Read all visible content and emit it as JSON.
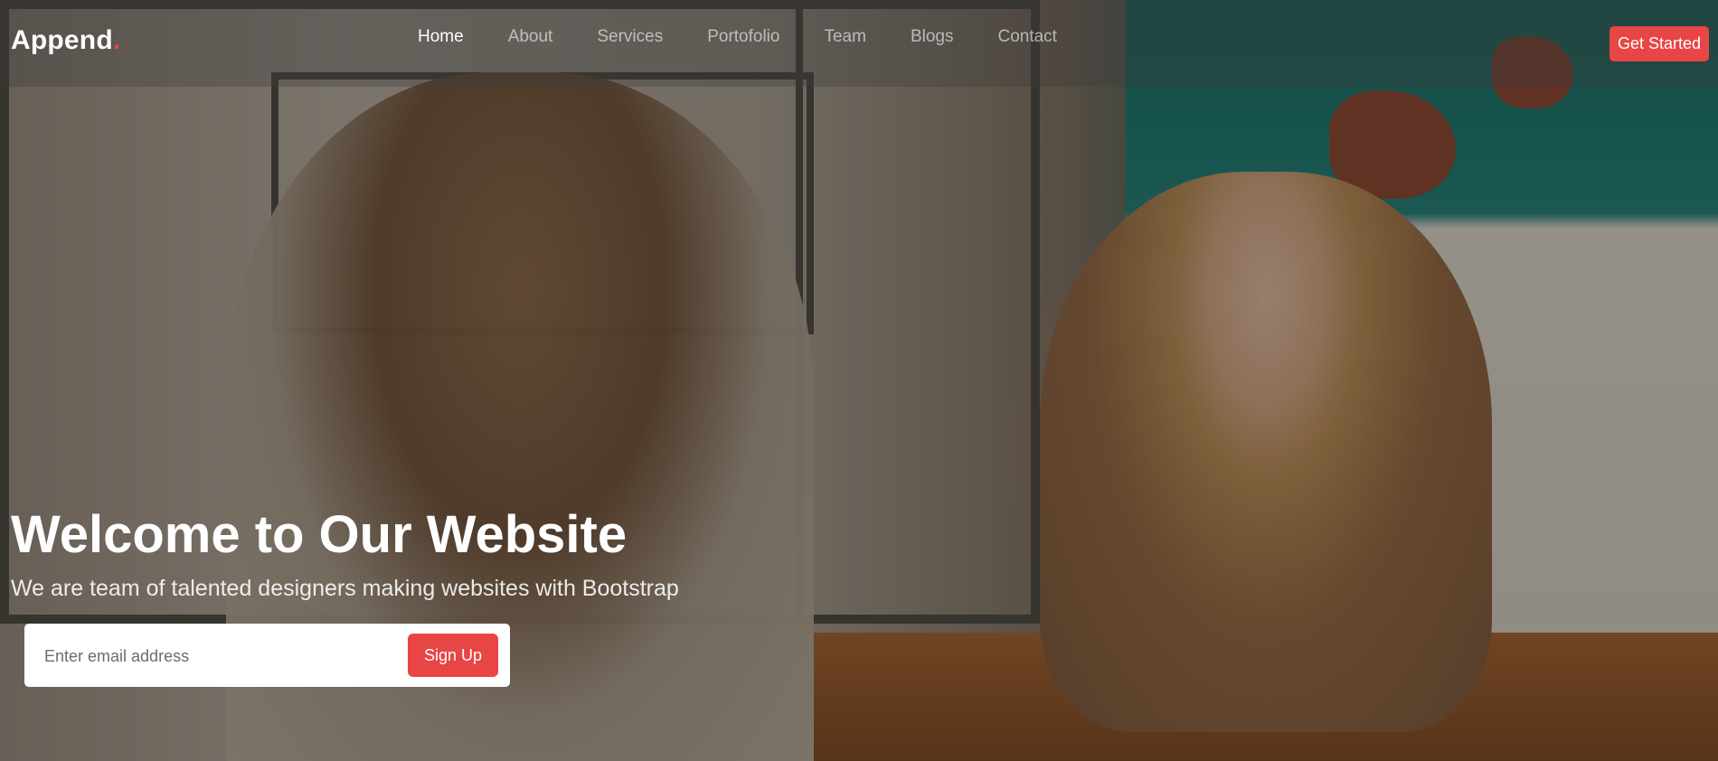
{
  "brand": {
    "name": "Append",
    "dot": ".",
    "accent_color": "#e84545"
  },
  "nav": {
    "items": [
      {
        "label": "Home",
        "active": true
      },
      {
        "label": "About",
        "active": false
      },
      {
        "label": "Services",
        "active": false
      },
      {
        "label": "Portofolio",
        "active": false
      },
      {
        "label": "Team",
        "active": false
      },
      {
        "label": "Blogs",
        "active": false
      },
      {
        "label": "Contact",
        "active": false
      }
    ],
    "cta_label": "Get Started"
  },
  "hero": {
    "title": "Welcome to Our Website",
    "subtitle": "We are team of talented designers making websites with Bootstrap",
    "email_placeholder": "Enter email address",
    "email_value": "",
    "signup_label": "Sign Up"
  }
}
